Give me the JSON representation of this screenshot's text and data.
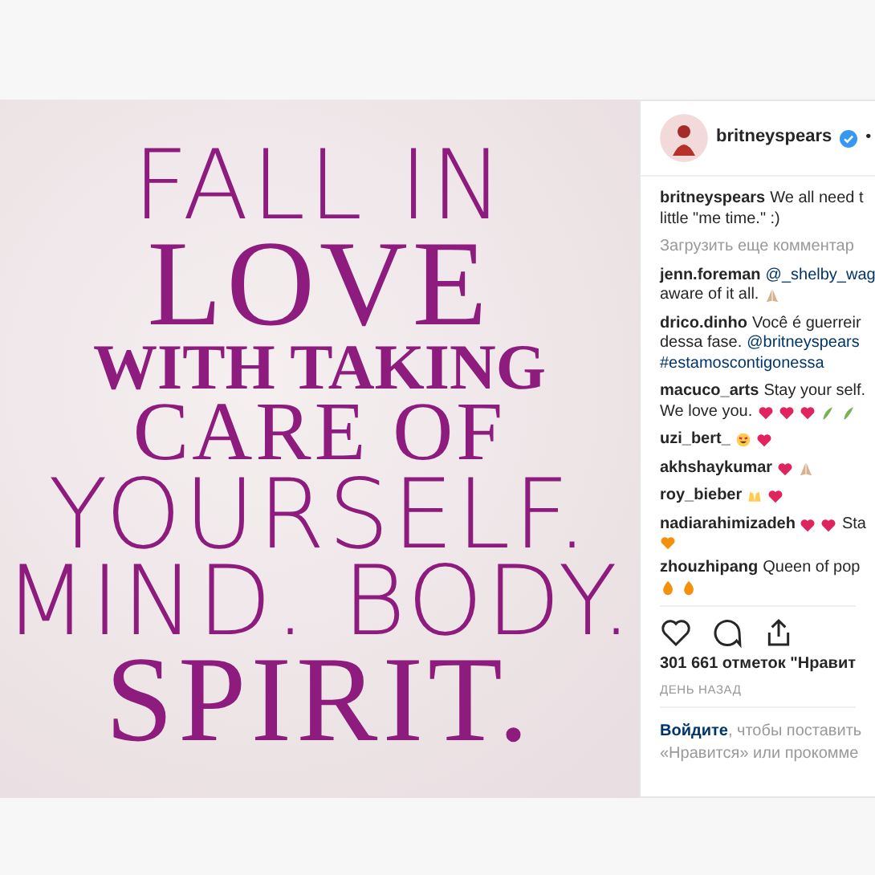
{
  "post_image": {
    "lines": [
      {
        "text": "FALL IN",
        "kind": "thin"
      },
      {
        "text": "LOVE",
        "kind": "serif"
      },
      {
        "text": "WITH TAKING",
        "kind": "serif-small"
      },
      {
        "text": "CARE OF",
        "kind": "serif-mid"
      },
      {
        "text": "YOURSELF.",
        "kind": "thin"
      },
      {
        "text": "MIND. BODY.",
        "kind": "thin"
      },
      {
        "text": "SPIRIT.",
        "kind": "serif"
      }
    ]
  },
  "header": {
    "username": "britneyspears",
    "verified": true,
    "separator": "•"
  },
  "caption": {
    "lines": [
      [
        {
          "kind": "user",
          "text": "britneyspears"
        },
        {
          "kind": "text",
          "text": "We all need t"
        }
      ],
      [
        {
          "kind": "text",
          "text": "little \"me time.\" :)"
        }
      ]
    ]
  },
  "load_more": "Загрузить еще комментар",
  "comments": [
    {
      "lines": [
        [
          {
            "kind": "user",
            "text": "jenn.foreman"
          },
          {
            "kind": "mention",
            "text": "@_shelby_wag"
          }
        ],
        [
          {
            "kind": "text",
            "text": "aware of it all."
          },
          {
            "kind": "pray"
          }
        ]
      ]
    },
    {
      "lines": [
        [
          {
            "kind": "user",
            "text": "drico.dinho"
          },
          {
            "kind": "text",
            "text": "Você é guerreir"
          }
        ],
        [
          {
            "kind": "text",
            "text": "dessa fase."
          },
          {
            "kind": "mention",
            "text": "@britneyspears"
          }
        ],
        [
          {
            "kind": "mention",
            "text": "#estamoscontigonessa"
          }
        ]
      ]
    },
    {
      "lines": [
        [
          {
            "kind": "user",
            "text": "macuco_arts"
          },
          {
            "kind": "text",
            "text": "Stay your self."
          }
        ],
        [
          {
            "kind": "text",
            "text": "We love you."
          },
          {
            "kind": "heart"
          },
          {
            "kind": "heart"
          },
          {
            "kind": "heart"
          },
          {
            "kind": "plant"
          },
          {
            "kind": "plant"
          }
        ]
      ]
    },
    {
      "lines": [
        [
          {
            "kind": "user",
            "text": "uzi_bert_"
          },
          {
            "kind": "smile"
          },
          {
            "kind": "heart"
          }
        ]
      ]
    },
    {
      "lines": [
        [
          {
            "kind": "user",
            "text": "akhshaykumar"
          },
          {
            "kind": "heart"
          },
          {
            "kind": "pray"
          }
        ]
      ]
    },
    {
      "lines": [
        [
          {
            "kind": "user",
            "text": "roy_bieber"
          },
          {
            "kind": "hands"
          },
          {
            "kind": "heart"
          }
        ]
      ]
    },
    {
      "lines": [
        [
          {
            "kind": "user",
            "text": "nadiarahimizadeh"
          },
          {
            "kind": "heart"
          },
          {
            "kind": "heart"
          },
          {
            "kind": "text",
            "text": "Sta"
          }
        ],
        [
          {
            "kind": "orange-heart"
          }
        ]
      ]
    },
    {
      "lines": [
        [
          {
            "kind": "user",
            "text": "zhouzhipang"
          },
          {
            "kind": "text",
            "text": "Queen of pop"
          }
        ],
        [
          {
            "kind": "flame"
          },
          {
            "kind": "flame"
          }
        ]
      ]
    }
  ],
  "likes": "301 661 отметок \"Нравит",
  "time": "ДЕНЬ НАЗАД",
  "login": {
    "link": "Войдите",
    "line1": ", чтобы поставить",
    "line2": "«Нравится» или прокомме"
  }
}
